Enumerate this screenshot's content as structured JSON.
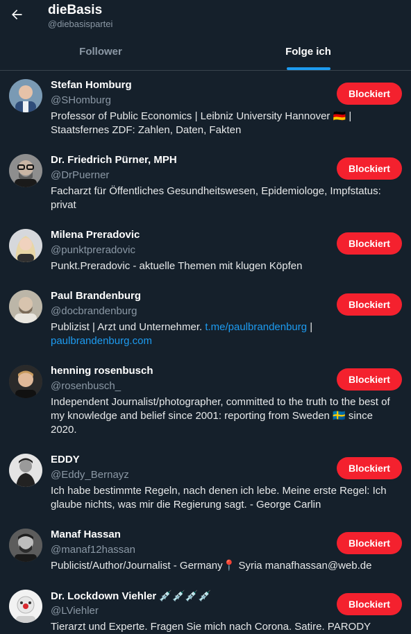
{
  "header": {
    "title": "dieBasis",
    "handle": "@diebasispartei",
    "back_icon": "arrow-left-icon"
  },
  "tabs": [
    {
      "label": "Follower",
      "active": false
    },
    {
      "label": "Folge ich",
      "active": true
    }
  ],
  "colors": {
    "background": "#15202b",
    "accent": "#1d9bf0",
    "blocked_button": "#f4212e",
    "muted_text": "#8b98a5"
  },
  "users": [
    {
      "name": "Stefan Homburg",
      "handle": "@SHomburg",
      "button": "Blockiert",
      "bio_line1": "Professor of Public Economics | Leibniz University Hannover 🇩🇪 |",
      "bio_line2": "Staatsfernes ZDF: Zahlen, Daten, Fakten"
    },
    {
      "name": "Dr. Friedrich Pürner, MPH",
      "handle": "@DrPuerner",
      "button": "Blockiert",
      "bio_line1": "Facharzt für Öffentliches Gesundheitswesen, Epidemiologe, Impfstatus:",
      "bio_line2": "privat"
    },
    {
      "name": "Milena Preradovic",
      "handle": "@punktpreradovic",
      "button": "Blockiert",
      "bio_line1": "Punkt.Preradovic - aktuelle Themen mit klugen Köpfen"
    },
    {
      "name": "Paul Brandenburg",
      "handle": "@docbrandenburg",
      "button": "Blockiert",
      "bio_prefix": "Publizist | Arzt und Unternehmer. ",
      "bio_link1": "t.me/paulbrandenburg",
      "bio_suffix": " |",
      "bio_link2": "paulbrandenburg.com"
    },
    {
      "name": "henning rosenbusch",
      "handle": "@rosenbusch_",
      "button": "Blockiert",
      "bio_line1": "Independent Journalist/photographer, committed to the truth to the best of",
      "bio_line2": "my knowledge and belief since 2001: reporting from Sweden 🇸🇪 since",
      "bio_line3": "2020."
    },
    {
      "name": "EDDY",
      "handle": "@Eddy_Bernayz",
      "button": "Blockiert",
      "bio_line1": "Ich habe bestimmte Regeln, nach denen ich lebe. Meine erste Regel: Ich",
      "bio_line2": "glaube nichts, was mir die Regierung sagt. - George Carlin"
    },
    {
      "name": "Manaf Hassan",
      "handle": "@manaf12hassan",
      "button": "Blockiert",
      "bio_line1": "Publicist/Author/Journalist - Germany📍 Syria manafhassan@web.de"
    },
    {
      "name": "Dr. Lockdown Viehler 💉💉💉💉",
      "handle": "@LViehler",
      "button": "Blockiert",
      "bio_line1": "Tierarzt und Experte. Fragen Sie mich nach Corona. Satire. PARODY"
    }
  ]
}
